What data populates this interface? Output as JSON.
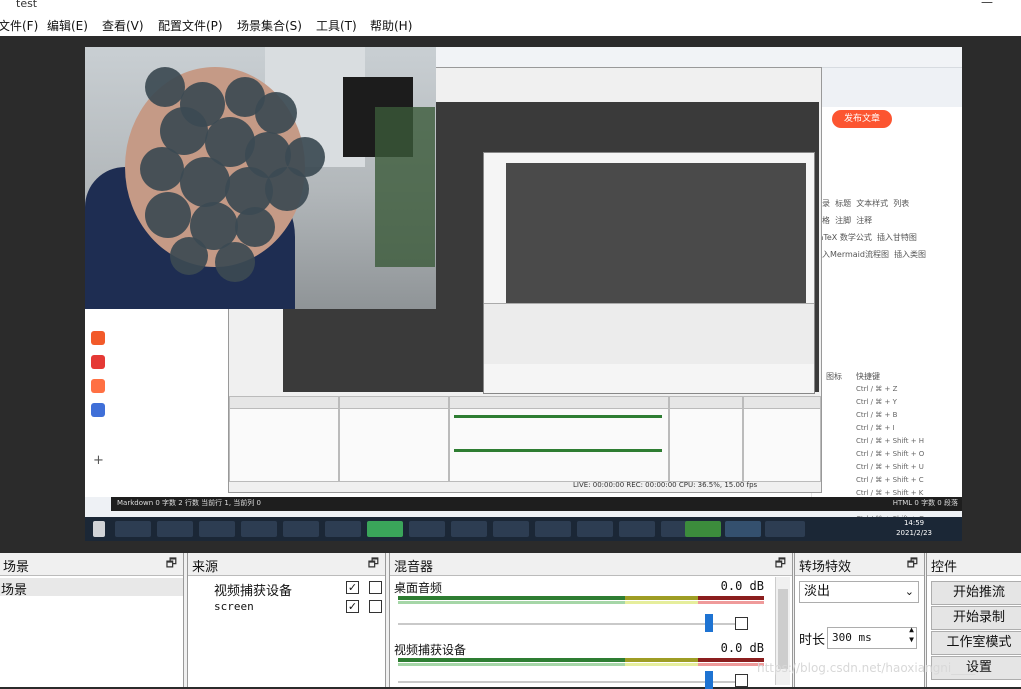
{
  "window": {
    "title": "test"
  },
  "menu": [
    {
      "label": "文件(F)"
    },
    {
      "label": "编辑(E)"
    },
    {
      "label": "查看(V)"
    },
    {
      "label": "配置文件(P)"
    },
    {
      "label": "场景集合(S)"
    },
    {
      "label": "工具(T)"
    },
    {
      "label": "帮助(H)"
    }
  ],
  "preview": {
    "taskbar_time": "14:59",
    "taskbar_date": "2021/2/23",
    "editor_status": "Markdown  0 字数  2 行数  当前行 1, 当前列 0",
    "editor_status_right": "HTML  0 字数  0 段落",
    "inner_obs_status": "LIVE: 00:00:00   REC: 00:00:00   CPU: 36.5%, 15.00 fps",
    "shortcuts_header": [
      "图标",
      "快捷键"
    ],
    "shortcuts": [
      "Ctrl / ⌘ + Z",
      "Ctrl / ⌘ + Y",
      "Ctrl / ⌘ + B",
      "Ctrl / ⌘ + I",
      "Ctrl / ⌘ + Shift + H",
      "Ctrl / ⌘ + Shift + O",
      "Ctrl / ⌘ + Shift + U",
      "Ctrl / ⌘ + Shift + C",
      "Ctrl / ⌘ + Shift + K",
      "Ctrl / ⌘ + Shift + L",
      "Ctrl / ⌘ + Shift + G"
    ],
    "publish_button": "发布文章",
    "tags": [
      "目录",
      "标题",
      "文本样式",
      "列表",
      "表格",
      "注脚",
      "注释",
      "LaTeX 数学公式",
      "插入甘特图",
      "插入Mermaid流程图",
      "插入类图"
    ]
  },
  "docks": {
    "scenes": {
      "title": "场景",
      "items": [
        "场景"
      ]
    },
    "sources": {
      "title": "来源",
      "items": [
        {
          "name": "视频捕获设备",
          "visible": true,
          "locked": false
        },
        {
          "name": "screen",
          "visible": true,
          "locked": false
        }
      ]
    },
    "mixer": {
      "title": "混音器",
      "channels": [
        {
          "name": "桌面音频",
          "db": "0.0 dB",
          "volume": 0.92
        },
        {
          "name": "视频捕获设备",
          "db": "0.0 dB",
          "volume": 0.92
        }
      ]
    },
    "transitions": {
      "title": "转场特效",
      "selected": "淡出",
      "duration_label": "时长",
      "duration_value": "300 ms"
    },
    "controls": {
      "title": "控件",
      "buttons": [
        "开始推流",
        "开始录制",
        "工作室模式",
        "设置"
      ]
    }
  },
  "watermark": "https://blog.csdn.net/haoxiangni____"
}
